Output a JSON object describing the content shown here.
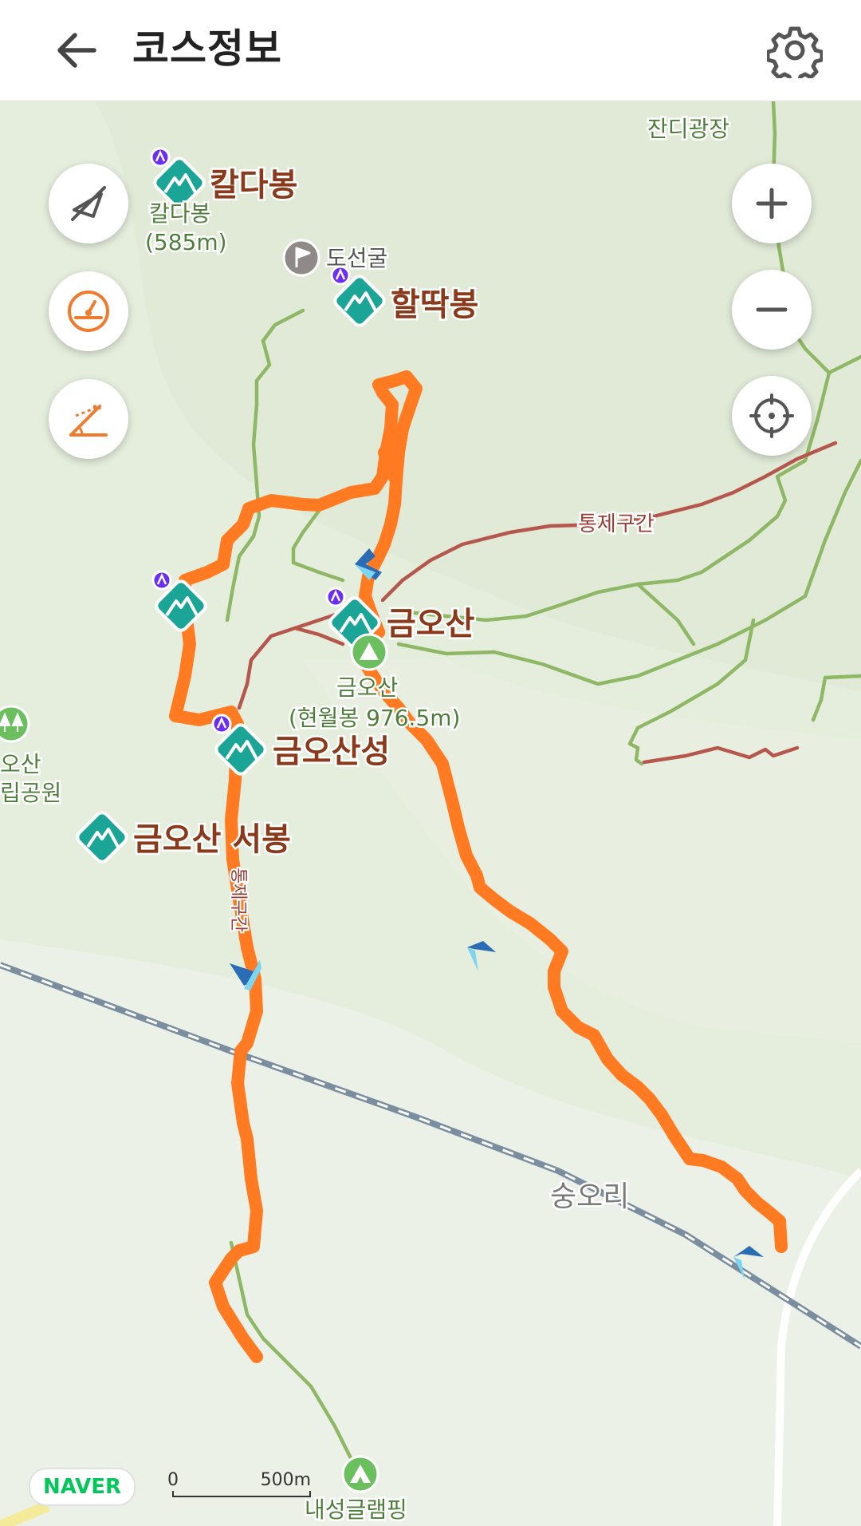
{
  "header": {
    "title": "코스정보",
    "back_icon": "arrow-left-icon",
    "settings_icon": "gear-icon"
  },
  "map_controls": {
    "left": [
      {
        "name": "compass-off-button",
        "icon": "compass-slash-icon"
      },
      {
        "name": "speedometer-button",
        "icon": "speedometer-icon"
      },
      {
        "name": "slope-button",
        "icon": "slope-icon"
      }
    ],
    "right": [
      {
        "name": "zoom-in-button",
        "icon": "plus-icon"
      },
      {
        "name": "zoom-out-button",
        "icon": "minus-icon"
      },
      {
        "name": "my-location-button",
        "icon": "crosshair-icon"
      }
    ]
  },
  "map": {
    "peaks": {
      "kaldabong": "칼다봉",
      "kaldabong_sub1": "칼다봉",
      "kaldabong_sub2": "(585m)",
      "hallddakbong": "할딱봉",
      "geumosan": "금오산",
      "geumosan_sub1": "금오산",
      "geumosan_sub2": "(현월봉 976.5m)",
      "geumosanseong": "금오산성",
      "geumosan_west": "금오산 서봉"
    },
    "places": {
      "doseongul": "도선굴",
      "jandi": "잔디광장",
      "restricted": "통제구간",
      "sungori": "숭오리",
      "camping": "내성글램핑",
      "park_1": "오산",
      "park_2": "립공원",
      "vertical_label": "통제구간"
    },
    "brand": "NAVER",
    "scale": {
      "zero": "0",
      "distance": "500m"
    }
  },
  "colors": {
    "route": "#ff7a20",
    "trail": "#8fb866",
    "restricted_trail": "#b5574d",
    "peak_marker": "#1aa596",
    "peak_label": "#8a3a1b",
    "map_bg": "#e3eddb",
    "naver": "#03c75a"
  }
}
